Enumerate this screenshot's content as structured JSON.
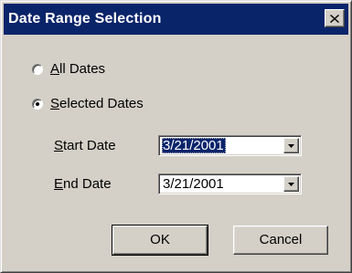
{
  "window": {
    "title": "Date Range Selection",
    "close_icon": "close-icon"
  },
  "options": {
    "all_dates": {
      "accel": "A",
      "rest": "ll Dates",
      "selected": false
    },
    "selected_dates": {
      "accel": "S",
      "rest": "elected Dates",
      "selected": true
    }
  },
  "start_date": {
    "label_accel": "S",
    "label_rest": "tart Date",
    "value": "3/21/2001"
  },
  "end_date": {
    "label_accel": "E",
    "label_rest": "nd Date",
    "value": "3/21/2001"
  },
  "buttons": {
    "ok": "OK",
    "cancel": "Cancel"
  },
  "colors": {
    "titlebar": "#0a246a",
    "face": "#d4d0c8",
    "selection": "#0a246a"
  }
}
